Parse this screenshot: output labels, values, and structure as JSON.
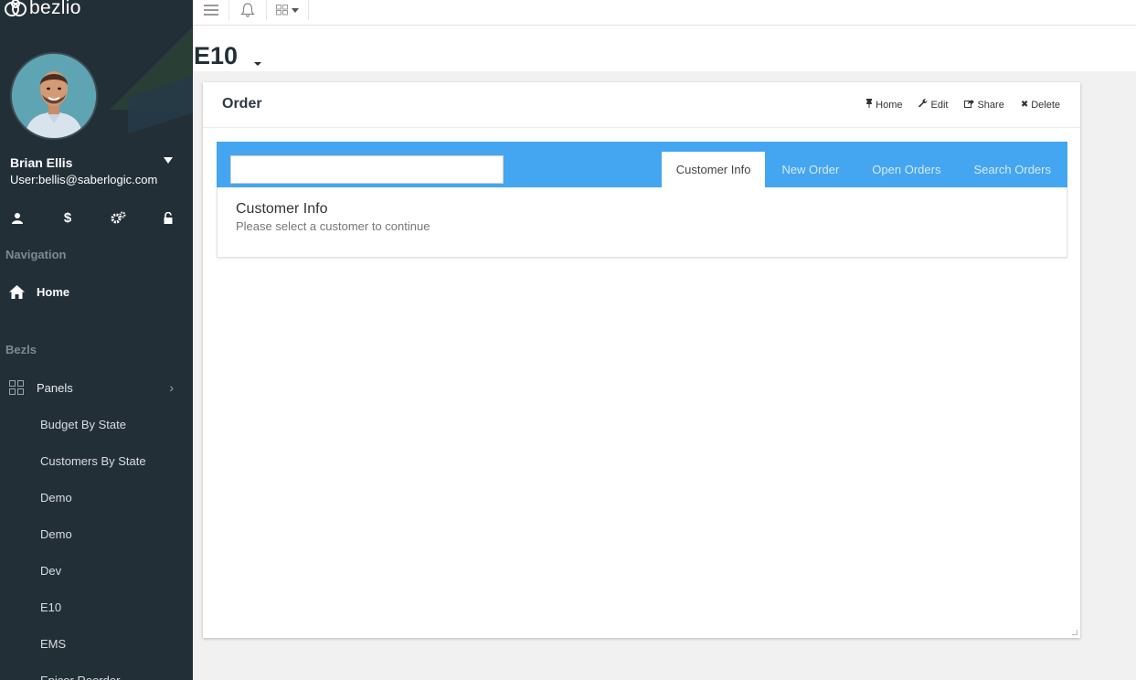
{
  "app": {
    "logo_text": "bezlio"
  },
  "user": {
    "name": "Brian Ellis",
    "email": "User:bellis@saberlogic.com"
  },
  "user_icons": [
    {
      "name": "user-icon",
      "glyph": "person"
    },
    {
      "name": "dollar-icon",
      "glyph": "$"
    },
    {
      "name": "cogs-icon",
      "glyph": "gears"
    },
    {
      "name": "unlock-icon",
      "glyph": "lock"
    }
  ],
  "nav": {
    "heading": "Navigation",
    "home_label": "Home",
    "bezls_heading": "Bezls",
    "panels_label": "Panels",
    "panel_items": [
      "Budget By State",
      "Customers By State",
      "Demo",
      "Demo",
      "Dev",
      "E10",
      "EMS",
      "Epicor Reorder"
    ]
  },
  "page": {
    "title": "E10"
  },
  "card": {
    "title": "Order",
    "actions": {
      "home": "Home",
      "edit": "Edit",
      "share": "Share",
      "delete": "Delete"
    },
    "search": {
      "value": "",
      "placeholder": ""
    },
    "tabs": [
      "Customer Info",
      "New Order",
      "Open Orders",
      "Search Orders"
    ],
    "active_tab": "Customer Info",
    "info": {
      "title": "Customer Info",
      "subtitle": "Please select a customer to continue"
    }
  },
  "colors": {
    "sidebar_bg": "#232f37",
    "accent_blue": "#44a6f0",
    "page_bg": "#f1f1f1"
  }
}
